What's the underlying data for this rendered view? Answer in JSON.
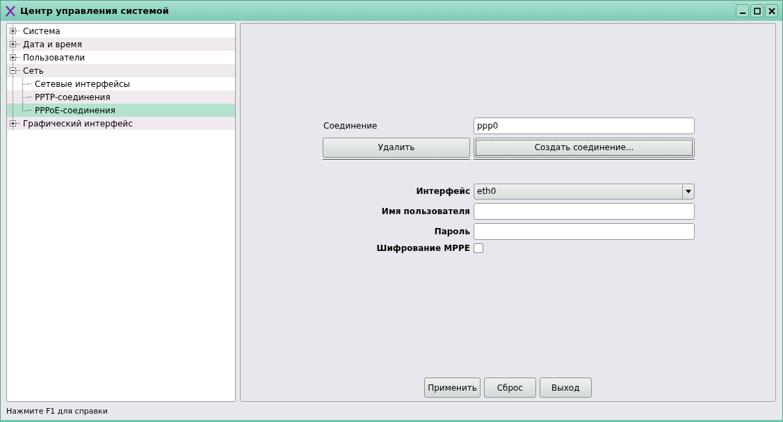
{
  "window": {
    "title": "Центр управления системой"
  },
  "tree": [
    {
      "label": "Система",
      "expanded": false,
      "selected": false
    },
    {
      "label": "Дата и время",
      "expanded": false,
      "selected": false
    },
    {
      "label": "Пользователи",
      "expanded": false,
      "selected": false
    },
    {
      "label": "Сеть",
      "expanded": true,
      "selected": false,
      "children": [
        {
          "label": "Сетевые интерфейсы",
          "selected": false
        },
        {
          "label": "PPTP-соединения",
          "selected": false
        },
        {
          "label": "PPPoE-соединения",
          "selected": true
        }
      ]
    },
    {
      "label": "Графический интерфейс",
      "expanded": false,
      "selected": false
    }
  ],
  "connection": {
    "label": "Соединение",
    "value": "ppp0",
    "delete_button": "Удалить",
    "create_button": "Создать соединение..."
  },
  "fields": [
    {
      "kind": "select",
      "label": "Интерфейс",
      "value": "eth0"
    },
    {
      "kind": "text",
      "label": "Имя пользователя"
    },
    {
      "kind": "password",
      "label": "Пароль"
    },
    {
      "kind": "checkbox",
      "label": "Шифрование MPPE",
      "checked": false
    }
  ],
  "buttons": [
    "Применить",
    "Сброс",
    "Выход"
  ],
  "status_bar": "Нажмите F1 для справки"
}
